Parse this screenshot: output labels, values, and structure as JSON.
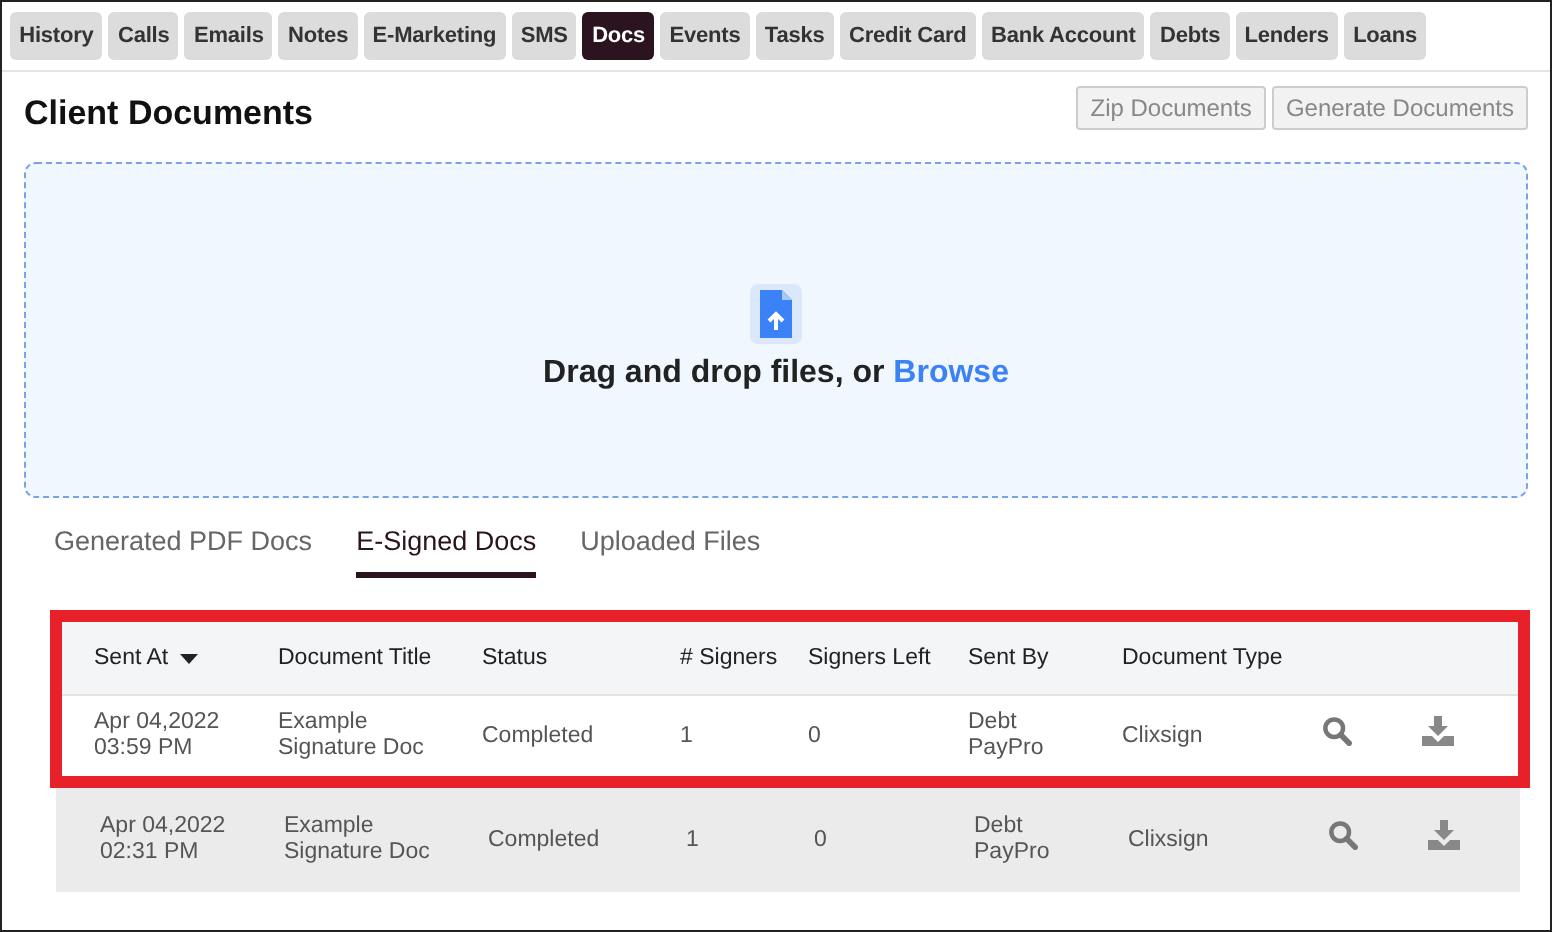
{
  "nav_tabs": [
    {
      "label": "History",
      "selected": false
    },
    {
      "label": "Calls",
      "selected": false
    },
    {
      "label": "Emails",
      "selected": false
    },
    {
      "label": "Notes",
      "selected": false
    },
    {
      "label": "E-Marketing",
      "selected": false
    },
    {
      "label": "SMS",
      "selected": false
    },
    {
      "label": "Docs",
      "selected": true
    },
    {
      "label": "Events",
      "selected": false
    },
    {
      "label": "Tasks",
      "selected": false
    },
    {
      "label": "Credit Card",
      "selected": false
    },
    {
      "label": "Bank Account",
      "selected": false
    },
    {
      "label": "Debts",
      "selected": false
    },
    {
      "label": "Lenders",
      "selected": false
    },
    {
      "label": "Loans",
      "selected": false
    }
  ],
  "section_title": "Client Documents",
  "buttons": [
    {
      "label": "Zip Documents",
      "disabled": true
    },
    {
      "label": "Generate Documents",
      "disabled": true
    }
  ],
  "dropzone": {
    "text": "Drag and drop files, or",
    "link": "Browse"
  },
  "doc_tabs": [
    {
      "label": "Generated PDF Docs",
      "selected": false
    },
    {
      "label": "E-Signed Docs",
      "selected": true
    },
    {
      "label": "Uploaded Files",
      "selected": false
    }
  ],
  "table": {
    "columns": [
      {
        "label": "Sent At",
        "sorted": true
      },
      {
        "label": "Document Title",
        "sorted": false
      },
      {
        "label": "Status",
        "sorted": false
      },
      {
        "label": "# Signers",
        "sorted": false
      },
      {
        "label": "Signers Left",
        "sorted": false
      },
      {
        "label": "Sent By",
        "sorted": false
      },
      {
        "label": "Document Type",
        "sorted": false
      }
    ],
    "rows": [
      {
        "highlighted": true,
        "cells": [
          "Apr 04,2022\n03:59 PM",
          "Example\nSignature Doc",
          "Completed",
          "1",
          "0",
          "Debt\nPayPro",
          "Clixsign"
        ]
      },
      {
        "highlighted": false,
        "cells": [
          "Apr 04,2022\n02:31 PM",
          "Example\nSignature Doc",
          "Completed",
          "1",
          "0",
          "Debt\nPayPro",
          "Clixsign"
        ]
      }
    ]
  }
}
